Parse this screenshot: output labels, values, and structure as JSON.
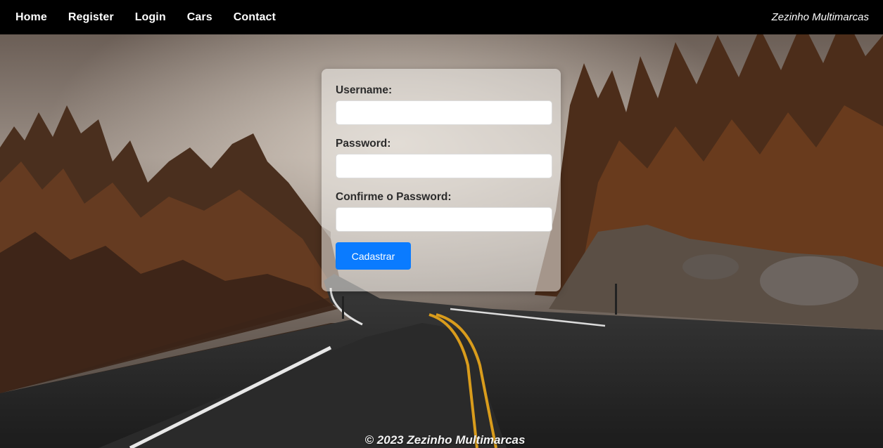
{
  "nav": {
    "items": [
      {
        "label": "Home",
        "name": "nav-home"
      },
      {
        "label": "Register",
        "name": "nav-register"
      },
      {
        "label": "Login",
        "name": "nav-login"
      },
      {
        "label": "Cars",
        "name": "nav-cars"
      },
      {
        "label": "Contact",
        "name": "nav-contact"
      }
    ],
    "brand": "Zezinho Multimarcas"
  },
  "form": {
    "username_label": "Username:",
    "username_value": "",
    "password_label": "Password:",
    "password_value": "",
    "confirm_label": "Confirme o Password:",
    "confirm_value": "",
    "submit_label": "Cadastrar"
  },
  "footer": {
    "text": "© 2023 Zezinho Multimarcas"
  },
  "colors": {
    "navbar": "#000000",
    "button": "#0a7bff",
    "card": "rgba(238,236,234,0.55)"
  }
}
